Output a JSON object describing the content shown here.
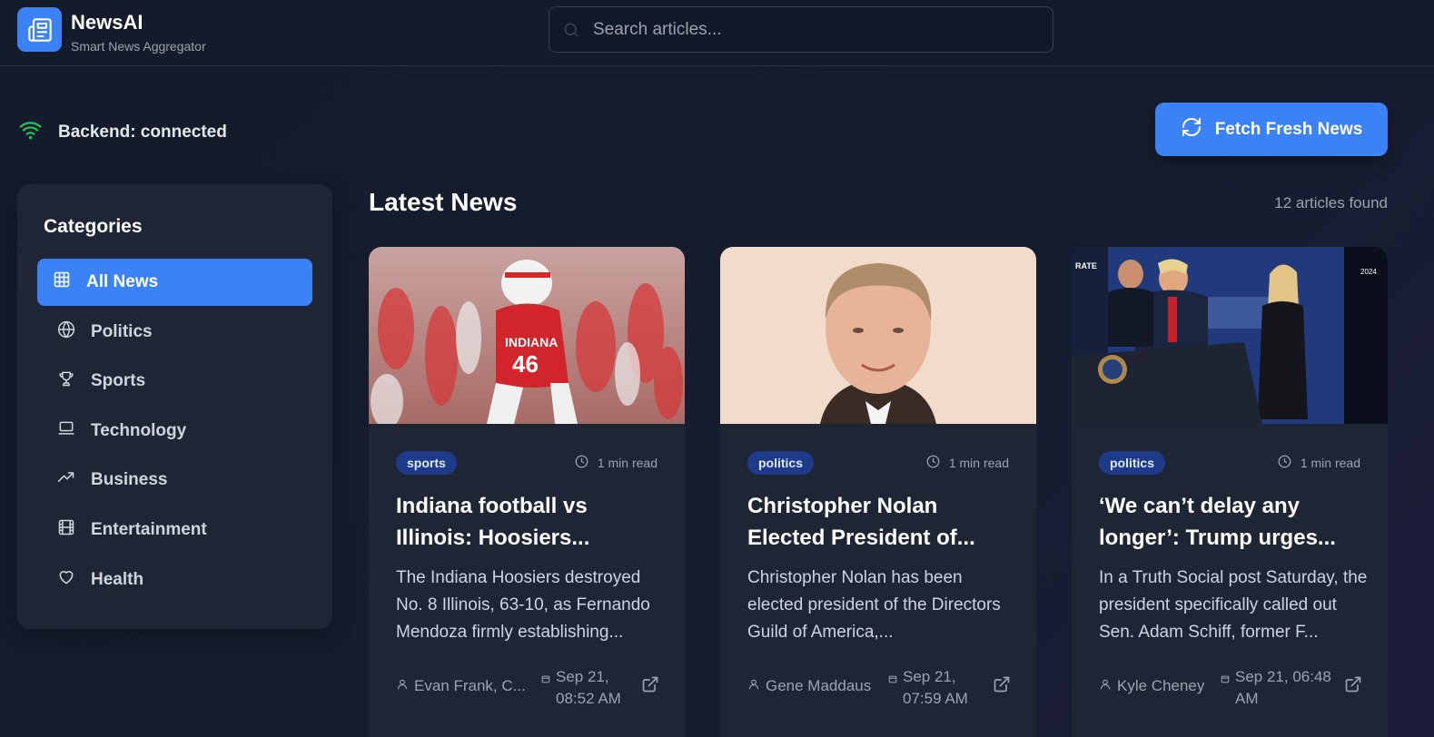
{
  "brand": {
    "name": "NewsAI",
    "subtitle": "Smart News Aggregator",
    "logo_icon": "newspaper-icon"
  },
  "search": {
    "placeholder": "Search articles..."
  },
  "status": {
    "text": "Backend: connected",
    "icon": "wifi-icon",
    "color": "#22c55e"
  },
  "fetch_button": {
    "label": "Fetch Fresh News",
    "icon": "refresh-icon"
  },
  "sidebar": {
    "title": "Categories",
    "items": [
      {
        "label": "All News",
        "icon": "grid-icon",
        "active": true
      },
      {
        "label": "Politics",
        "icon": "globe-icon"
      },
      {
        "label": "Sports",
        "icon": "trophy-icon"
      },
      {
        "label": "Technology",
        "icon": "laptop-icon"
      },
      {
        "label": "Business",
        "icon": "trending-up-icon"
      },
      {
        "label": "Entertainment",
        "icon": "film-icon"
      },
      {
        "label": "Health",
        "icon": "heart-icon"
      }
    ]
  },
  "main": {
    "title": "Latest News",
    "count": "12 articles found"
  },
  "articles": [
    {
      "category": "sports",
      "read_time": "1 min read",
      "title": "Indiana football vs Illinois: Hoosiers...",
      "description": "The Indiana Hoosiers destroyed No. 8 Illinois, 63-10, as Fernando Mendoza firmly establishing...",
      "author": "Evan Frank, C...",
      "date_line1": "Sep 21,",
      "date_line2": "08:52 AM"
    },
    {
      "category": "politics",
      "read_time": "1 min read",
      "title": "Christopher Nolan Elected President of...",
      "description": "Christopher Nolan has been elected president of the Directors Guild of America,...",
      "author": "Gene Maddaus",
      "date_line1": "Sep 21,",
      "date_line2": "07:59 AM"
    },
    {
      "category": "politics",
      "read_time": "1 min read",
      "title": "‘We can’t delay any longer’: Trump urges...",
      "description": "In a Truth Social post Saturday, the president specifically called out Sen. Adam Schiff, former F...",
      "author": "Kyle Cheney",
      "date_line1": "Sep 21, 06:48",
      "date_line2": "AM"
    }
  ],
  "colors": {
    "accent": "#3b82f6",
    "badge_bg": "#1e3a8a",
    "card_bg": "#1e2636"
  }
}
